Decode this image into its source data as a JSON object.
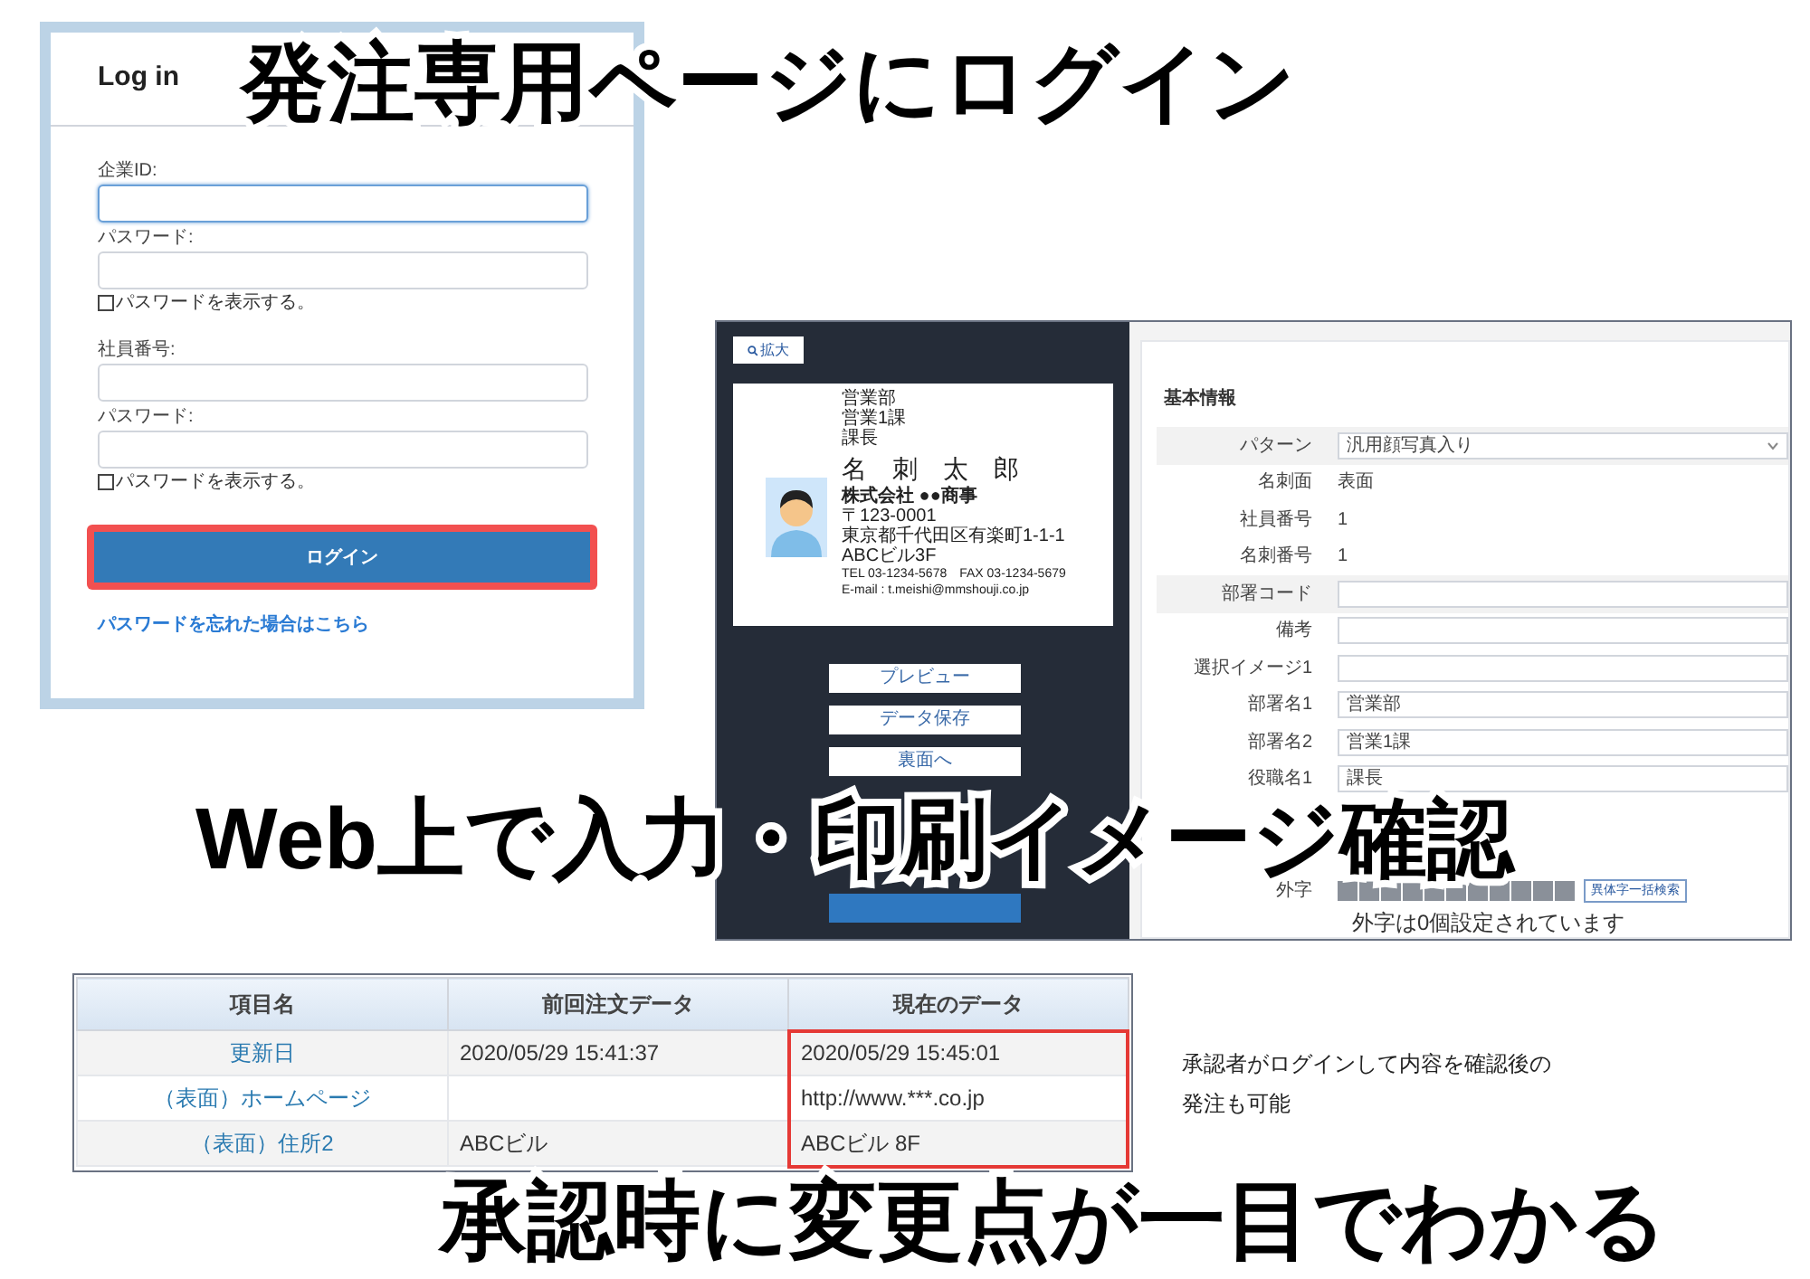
{
  "captions": [
    "発注専用ページにログイン",
    "Web上で入力・印刷イメージ確認",
    "承認時に変更点が一目でわかる"
  ],
  "login": {
    "title": "Log in",
    "fields": [
      {
        "kind": "input",
        "label": "企業ID:",
        "focused": true
      },
      {
        "kind": "input",
        "label": "パスワード:",
        "focused": false
      },
      {
        "kind": "checkbox",
        "label": "パスワードを表示する。",
        "checked": false
      },
      {
        "kind": "input",
        "label": "社員番号:",
        "focused": false
      },
      {
        "kind": "input",
        "label": "パスワード:",
        "focused": false
      },
      {
        "kind": "checkbox",
        "label": "パスワードを表示する。",
        "checked": false
      }
    ],
    "button": {
      "label": "ログイン",
      "highlighted": true
    },
    "link": "パスワードを忘れた場合はこちら"
  },
  "editor": {
    "zoom_button": "拡大",
    "card": {
      "lines_top": [
        "営業部",
        "営業1課",
        "課長"
      ],
      "name": "名　刺　太　郎",
      "company": "株式会社 ●●商事",
      "lines_bottom": [
        "〒123-0001",
        "東京都千代田区有楽町1-1-1",
        "ABCビル3F",
        "TEL 03-1234-5678　FAX 03-1234-5679",
        "E-mail : t.meishi@mmshouji.co.jp"
      ]
    },
    "buttons": [
      "プレビュー",
      "データ保存",
      "裏面へ"
    ],
    "section": "基本情報",
    "rows": [
      {
        "kind": "select",
        "label": "パターン",
        "value": "汎用顔写真入り"
      },
      {
        "kind": "text",
        "label": "名刺面",
        "value": "表面"
      },
      {
        "kind": "text",
        "label": "社員番号",
        "value": "1"
      },
      {
        "kind": "text",
        "label": "名刺番号",
        "value": "1"
      },
      {
        "kind": "input",
        "label": "部署コード",
        "value": ""
      },
      {
        "kind": "input",
        "label": "備考",
        "value": ""
      },
      {
        "kind": "input",
        "label": "選択イメージ1",
        "value": ""
      },
      {
        "kind": "input",
        "label": "部署名1",
        "value": "営業部"
      },
      {
        "kind": "input",
        "label": "部署名2",
        "value": "営業1課"
      },
      {
        "kind": "input",
        "label": "役職名1",
        "value": "課長"
      },
      {
        "kind": "gap"
      },
      {
        "kind": "gap"
      },
      {
        "kind": "gaiji",
        "label": "外字",
        "value": "異体字一括検索"
      }
    ],
    "note": "外字は0個設定されています"
  },
  "table": {
    "columns": [
      "項目名",
      "前回注文データ",
      "現在のデータ"
    ],
    "rows": [
      {
        "cells": [
          "更新日",
          "2020/05/29 15:41:37",
          "2020/05/29 15:45:01"
        ],
        "changed": true
      },
      {
        "cells": [
          "（表面）ホームページ",
          "",
          "http://www.***.co.jp"
        ],
        "changed": true
      },
      {
        "cells": [
          "（表面）住所2",
          "ABCビル",
          "ABCビル 8F"
        ],
        "changed": true
      }
    ]
  },
  "approval_note": [
    "承認者がログインして内容を確認後の",
    "発注も可能"
  ]
}
